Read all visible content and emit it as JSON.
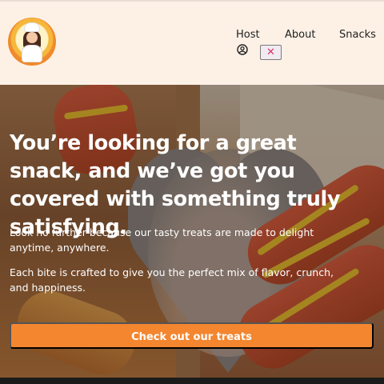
{
  "header": {
    "logo_icon": "chef-girl-logo",
    "nav": [
      {
        "label": "Host"
      },
      {
        "label": "About"
      },
      {
        "label": "Snacks"
      }
    ],
    "user_icon": "user-circle-icon",
    "close_symbol": "✕"
  },
  "hero": {
    "title": "You’re looking for a great snack, and we’ve got you covered with something truly satisfying.",
    "paragraph_1": "Look no further because our tasty treats are made to delight anytime, anywhere.",
    "paragraph_2": "Each bite is crafted to give you the perfect mix of flavor, crunch, and happiness.",
    "cta_label": "Check out our treats"
  },
  "colors": {
    "accent": "#f4862f",
    "header_bg": "#fdf1e6",
    "close_icon": "#d8336a"
  }
}
